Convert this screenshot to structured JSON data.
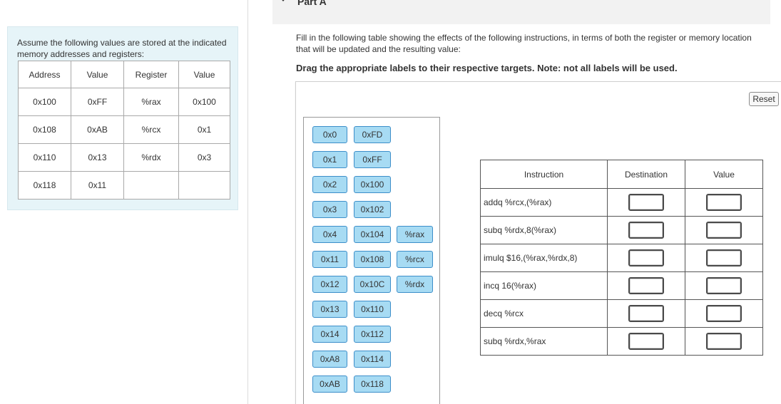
{
  "info": {
    "text": "Assume the following values are stored at the indicated memory addresses and registers:",
    "headers": [
      "Address",
      "Value",
      "Register",
      "Value"
    ],
    "rows": [
      [
        "0x100",
        "0xFF",
        "%rax",
        "0x100"
      ],
      [
        "0x108",
        "0xAB",
        "%rcx",
        "0x1"
      ],
      [
        "0x110",
        "0x13",
        "%rdx",
        "0x3"
      ],
      [
        "0x118",
        "0x11",
        "",
        ""
      ]
    ]
  },
  "part": {
    "title": "Part A"
  },
  "instructions": "Fill in the following table showing the effects of the following instructions, in terms of both the register or memory location that will be updated and the resulting value:",
  "drag_note": "Drag the appropriate labels to their respective targets. Note: not all labels will be used.",
  "reset_label": "Reset",
  "labels": {
    "col1": [
      "0x0",
      "0x1",
      "0x2",
      "0x3",
      "0x4",
      "0x11",
      "0x12",
      "0x13",
      "0x14",
      "0xA8",
      "0xAB"
    ],
    "col2": [
      "0xFD",
      "0xFF",
      "0x100",
      "0x102",
      "0x104",
      "0x108",
      "0x10C",
      "0x110",
      "0x112",
      "0x114",
      "0x118"
    ],
    "col3": [
      "%rax",
      "%rcx",
      "%rdx"
    ]
  },
  "answer_table": {
    "headers": [
      "Instruction",
      "Destination",
      "Value"
    ],
    "rows": [
      "addq %rcx,(%rax)",
      "subq %rdx,8(%rax)",
      "imulq $16,(%rax,%rdx,8)",
      "incq 16(%rax)",
      "decq %rcx",
      "subq %rdx,%rax"
    ]
  }
}
